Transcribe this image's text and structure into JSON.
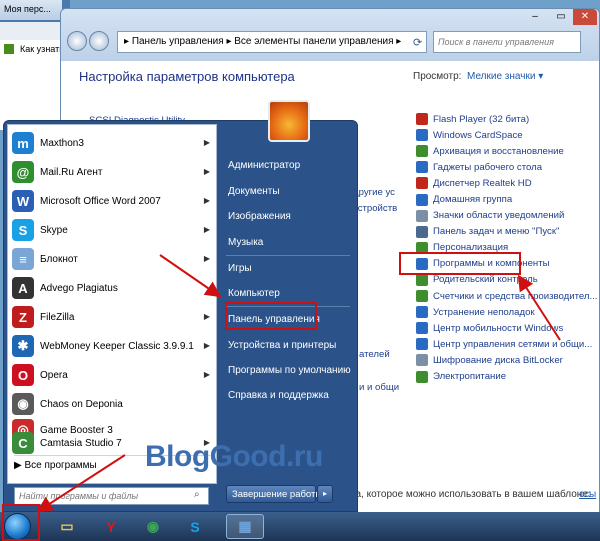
{
  "browser": {
    "tab_title": "Моя перс...",
    "page_link": "Как узнать"
  },
  "control_panel": {
    "window_buttons": [
      "–",
      "▭",
      "✕"
    ],
    "address": [
      "Панель управления",
      "Все элементы панели управления"
    ],
    "search_placeholder": "Поиск в панели управления",
    "title": "Настройка параметров компьютера",
    "view_label": "Просмотр:",
    "view_value": "Мелкие значки ▾",
    "items": [
      {
        "label": "Flash Player (32 бита)",
        "color": "#c0281c"
      },
      {
        "label": "Windows CardSpace",
        "color": "#2a6bc2"
      },
      {
        "label": "Архивация и восстановление",
        "color": "#3e8e2f"
      },
      {
        "label": "Гаджеты рабочего стола",
        "color": "#2a6bc2"
      },
      {
        "label": "Диспетчер Realtek HD",
        "color": "#c0281c"
      },
      {
        "label": "Домашняя группа",
        "color": "#2a6bc2"
      },
      {
        "label": "Значки области уведомлений",
        "color": "#7b8fa6"
      },
      {
        "label": "Панель задач и меню \"Пуск\"",
        "color": "#4a6a8e"
      },
      {
        "label": "Персонализация",
        "color": "#3e8e2f"
      },
      {
        "label": "Программы и компоненты",
        "color": "#2a6bc2"
      },
      {
        "label": "Родительский контроль",
        "color": "#3e8e2f"
      },
      {
        "label": "Счетчики и средства производител...",
        "color": "#3e8e2f"
      },
      {
        "label": "Устранение неполадок",
        "color": "#2a6bc2"
      },
      {
        "label": "Центр мобильности Windows",
        "color": "#2a6bc2"
      },
      {
        "label": "Центр управления сетями и общи...",
        "color": "#2a6bc2"
      },
      {
        "label": "Шифрование диска BitLocker",
        "color": "#7b8fa6"
      },
      {
        "label": "Электропитание",
        "color": "#3e8e2f"
      }
    ],
    "partial_items": [
      "SCSI Diagnostic Utility",
      "другие ус",
      "устройств",
      "ателей",
      "и и общи"
    ],
    "bottom_text": "нкста, которое можно использовать в вашем шаблоне:",
    "bottom_link": "ссы"
  },
  "start_menu": {
    "programs": [
      {
        "label": "Maxthon3",
        "icon": "maxthon-icon",
        "glyph": "m",
        "color": "#1f7fd1",
        "arrow": true
      },
      {
        "label": "Mail.Ru Агент",
        "icon": "mail-ru-agent-icon",
        "glyph": "@",
        "color": "#2f8f2f",
        "arrow": true
      },
      {
        "label": "Microsoft Office Word 2007",
        "icon": "word-icon",
        "glyph": "W",
        "color": "#2b5fb4",
        "arrow": true
      },
      {
        "label": "Skype",
        "icon": "skype-icon",
        "glyph": "S",
        "color": "#19a1e5",
        "arrow": true
      },
      {
        "label": "Блокнот",
        "icon": "notepad-icon",
        "glyph": "≡",
        "color": "#7aa6d6",
        "arrow": true
      },
      {
        "label": "Advego Plagiatus",
        "icon": "advego-icon",
        "glyph": "A",
        "color": "#333333",
        "arrow": false
      },
      {
        "label": "FileZilla",
        "icon": "filezilla-icon",
        "glyph": "Z",
        "color": "#bf1d1d",
        "arrow": true
      },
      {
        "label": "WebMoney Keeper Classic 3.9.9.1",
        "icon": "webmoney-icon",
        "glyph": "✱",
        "color": "#2067b3",
        "arrow": true
      },
      {
        "label": "Opera",
        "icon": "opera-icon",
        "glyph": "O",
        "color": "#cc1020",
        "arrow": true
      },
      {
        "label": "Chaos on Deponia",
        "icon": "deponia-icon",
        "glyph": "◉",
        "color": "#5a5a5a",
        "arrow": false
      },
      {
        "label": "Game Booster 3",
        "icon": "game-booster-icon",
        "glyph": "◎",
        "color": "#c92b2b",
        "arrow": false
      },
      {
        "label": "Camtasia Studio 7",
        "icon": "camtasia-icon",
        "glyph": "C",
        "color": "#3a8c3a",
        "arrow": true
      }
    ],
    "all_programs": "Все программы",
    "search_placeholder": "Найти программы и файлы",
    "right_items": [
      "Администратор",
      "Документы",
      "Изображения",
      "Музыка",
      "Игры",
      "Компьютер",
      "Панель управления",
      "Устройства и принтеры",
      "Программы по умолчанию",
      "Справка и поддержка"
    ],
    "shutdown_label": "Завершение работы",
    "shutdown_arrow": "▸"
  },
  "watermark": "BlogGood.ru",
  "taskbar": {
    "pinned": [
      {
        "name": "explorer",
        "glyph": "▭",
        "color": "#f0c541"
      },
      {
        "name": "yandex",
        "glyph": "Y",
        "color": "#e8141a"
      },
      {
        "name": "chrome",
        "glyph": "◉",
        "color": "#3aa757"
      },
      {
        "name": "skype",
        "glyph": "S",
        "color": "#19a1e5"
      },
      {
        "name": "control-panel",
        "glyph": "▦",
        "color": "#6fa2d8"
      }
    ]
  },
  "colors": {
    "highlight": "#d01010",
    "link": "#1f3f8c",
    "start_menu_bg": "#2c5389"
  }
}
